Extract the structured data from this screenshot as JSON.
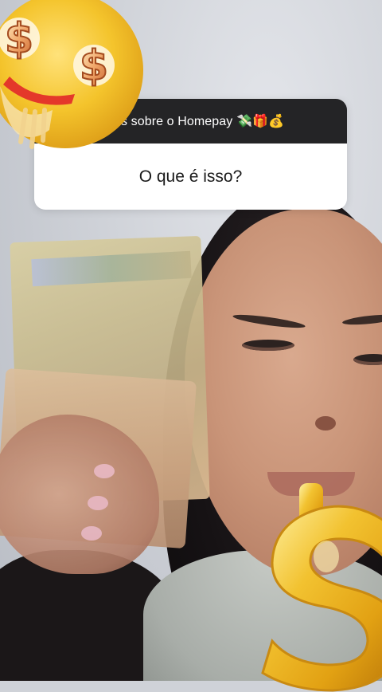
{
  "story": {
    "question_header": "s sobre o Homepay 💸🎁💰",
    "question_answer": "O que é isso?"
  },
  "stickers": {
    "top_left": "money-mouth-face-icon",
    "bottom_right": "gold-dollar-sign-icon"
  },
  "colors": {
    "card_header": "#242426",
    "card_body": "#ffffff",
    "emoji_yellow": "#f4c42c",
    "gold": "#e6b320"
  }
}
